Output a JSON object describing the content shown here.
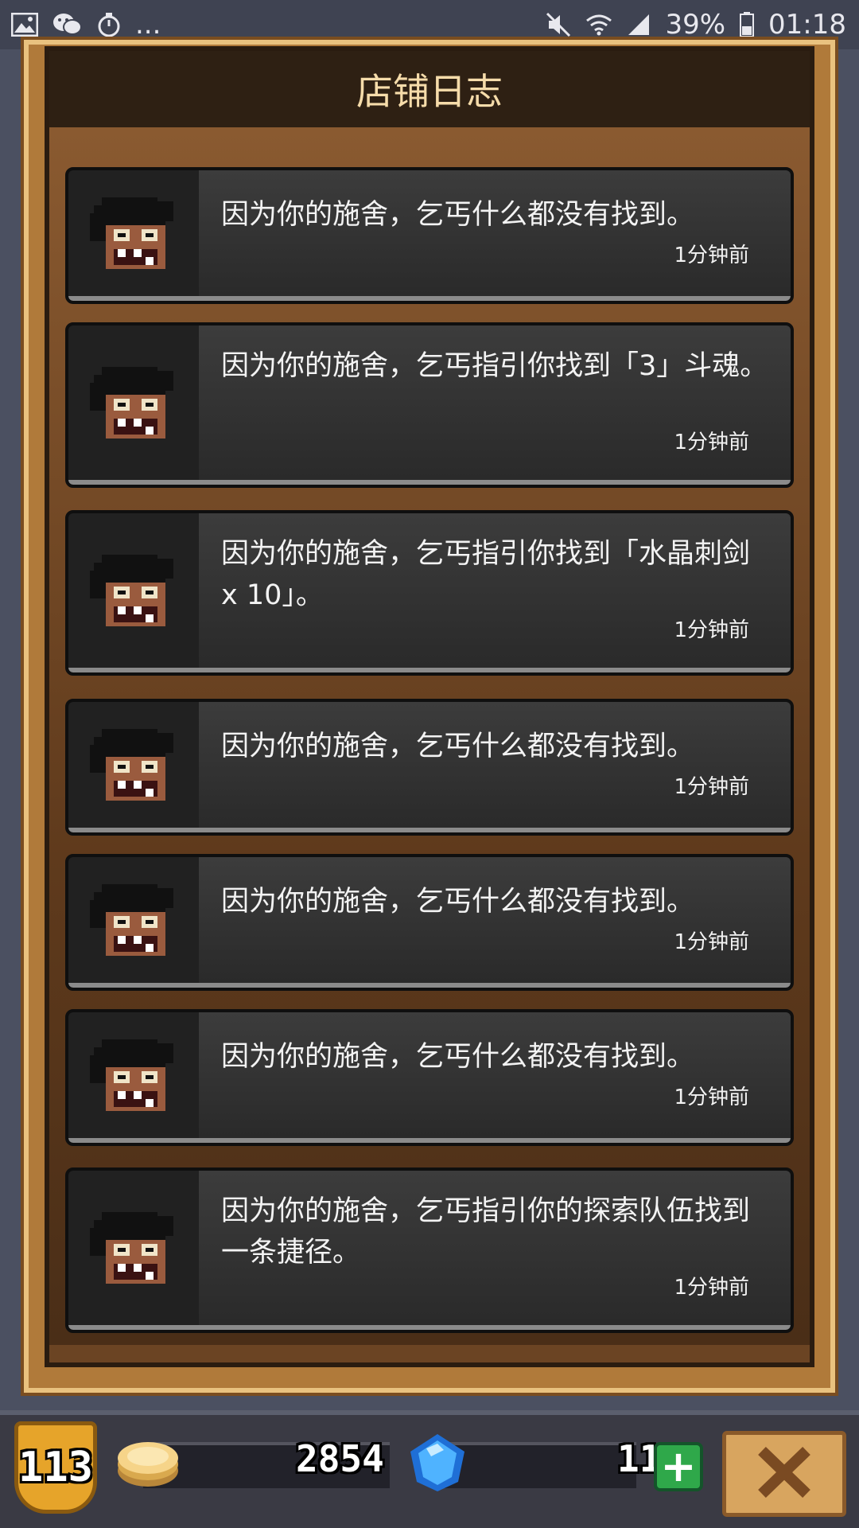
{
  "status_bar": {
    "left_icons": [
      "image-icon",
      "wechat-icon",
      "timer-icon"
    ],
    "more": "...",
    "battery": "39%",
    "time": "01:18"
  },
  "panel": {
    "title": "店铺日志"
  },
  "entries": [
    {
      "message": "因为你的施舍，乞丐什么都没有找到。",
      "time": "1分钟前"
    },
    {
      "message": "因为你的施舍，乞丐指引你找到「3」斗魂。",
      "time": "1分钟前"
    },
    {
      "message": "因为你的施舍，乞丐指引你找到「水晶刺剑 x 10」。",
      "time": "1分钟前"
    },
    {
      "message": "因为你的施舍，乞丐什么都没有找到。",
      "time": "1分钟前"
    },
    {
      "message": "因为你的施舍，乞丐什么都没有找到。",
      "time": "1分钟前"
    },
    {
      "message": "因为你的施舍，乞丐什么都没有找到。",
      "time": "1分钟前"
    },
    {
      "message": "因为你的施舍，乞丐指引你的探索队伍找到一条捷径。",
      "time": "1分钟前"
    }
  ],
  "bottom_bar": {
    "level": "113",
    "coins": "2854",
    "gems": "11",
    "plus_label": "+",
    "close_icon": "close-icon"
  },
  "colors": {
    "frame_gold": "#e9c27f",
    "title_bg": "#2e2013",
    "title_text": "#f6dcaa",
    "entry_bg": "#333333",
    "plus_green": "#2fa84a"
  }
}
